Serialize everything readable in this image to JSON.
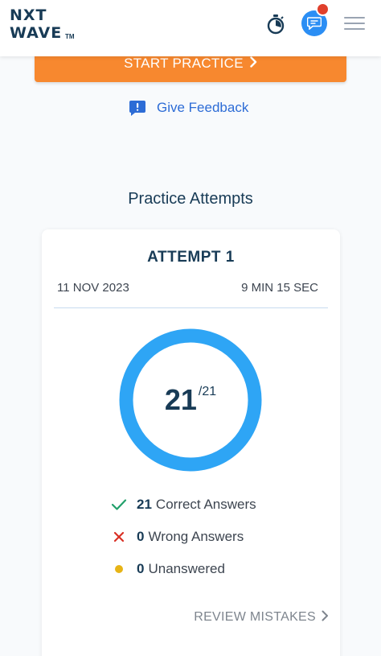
{
  "header": {
    "logo_line1": "NXT",
    "logo_line2": "WAVE",
    "logo_tm": "TM",
    "icons": [
      "stopwatch-icon",
      "chat-icon",
      "notification-dot",
      "hamburger-menu-icon"
    ],
    "colors": {
      "chat_button": "#2b8ef4",
      "notification_dot": "#e0402c",
      "brand_text": "#183b56"
    }
  },
  "start_practice": {
    "label": "START PRACTICE",
    "color": "#f7882f"
  },
  "feedback": {
    "label": "Give Feedback",
    "color": "#2d6cd6"
  },
  "practice_attempts": {
    "title": "Practice Attempts",
    "attempt": {
      "title": "ATTEMPT 1",
      "date": "11 NOV 2023",
      "duration": "9 MIN 15 SEC",
      "score": "21",
      "total": "/21",
      "score_fraction": 1.0,
      "ring_color": "#2ea5f5",
      "stats": {
        "correct": {
          "count": "21",
          "label": "Correct Answers",
          "color": "#22a06b"
        },
        "wrong": {
          "count": "0",
          "label": "Wrong Answers",
          "color": "#d93025"
        },
        "unanswered": {
          "count": "0",
          "label": "Unanswered",
          "color": "#e7b416"
        }
      },
      "review_label": "REVIEW MISTAKES"
    }
  }
}
